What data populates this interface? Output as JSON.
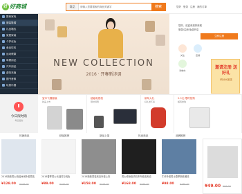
{
  "header": {
    "logo_text": "好商城",
    "search": {
      "category": "商品",
      "placeholder": "请输入您要搜索的商品关键字",
      "button": "搜索"
    },
    "user_links": [
      "您好",
      "登录",
      "注册",
      "我的订单"
    ]
  },
  "sidebar": {
    "items": [
      {
        "label": "数码家电",
        "active": false
      },
      {
        "label": "服装鞋帽",
        "active": true
      },
      {
        "label": "礼品箱包",
        "active": false
      },
      {
        "label": "家居家装",
        "active": false
      },
      {
        "label": "个护化妆",
        "active": false
      },
      {
        "label": "食品饮料",
        "active": false
      },
      {
        "label": "运动健康",
        "active": false
      },
      {
        "label": "母婴用品",
        "active": false
      },
      {
        "label": "汽车用品",
        "active": false
      },
      {
        "label": "虚拟充值",
        "active": false
      },
      {
        "label": "图书音像",
        "active": false
      },
      {
        "label": "玩具乐器",
        "active": false
      }
    ]
  },
  "hero": {
    "title": "NEW COLLECTION",
    "subtitle": "2016 · 开春新涉调"
  },
  "right_panel": {
    "links": [
      "您好，欢迎来到好商城",
      "登录/注册 免费开店"
    ],
    "button": "立即注册",
    "icons": [
      {
        "name": "heart-icon",
        "label": "关注"
      },
      {
        "name": "shop-icon",
        "label": "店铺"
      },
      {
        "name": "cart-icon",
        "label": "购物车"
      }
    ],
    "promo_big": "邀请注册 送好礼",
    "promo_small": "积分大放送"
  },
  "today": {
    "label": "今日限时购",
    "sub": "每日更新"
  },
  "mid_cards": [
    {
      "title": "宝中飞蝶服装",
      "subtitle": "新品上市"
    },
    {
      "title": "超级电视机",
      "subtitle": "限时特惠"
    },
    {
      "title": "新年大礼",
      "subtitle": "好礼送不停"
    },
    {
      "title": "9.9元 限时抢购",
      "subtitle": "超值抢购"
    }
  ],
  "category_tabs": [
    "热销商品",
    "精品推荐",
    "新品上架",
    "热卖商品",
    "品牌推荐"
  ],
  "products": [
    {
      "name": "2016新款男士西装休闲外套男装",
      "price": "¥128.00",
      "old": "¥199.00"
    },
    {
      "name": "2016春季男士长袖衬衫纯色",
      "price": "¥89.00",
      "old": "¥150.00"
    },
    {
      "name": "2016新款男装夹克外套上衣",
      "price": "¥158.00",
      "old": "¥226.00"
    },
    {
      "name": "男士修身皮衣机车外套皮夹克",
      "price": "¥168.00",
      "old": "¥299.00"
    },
    {
      "name": "牛仔外套男士春季新款潮流",
      "price": "¥98.00",
      "old": "¥168.00"
    }
  ],
  "float_panel": {
    "price": "¥49.00",
    "old": "¥99.00"
  },
  "colors": {
    "accent": "#f07a1c",
    "sidebar": "#1f2c3a",
    "price": "#e43c2a"
  }
}
